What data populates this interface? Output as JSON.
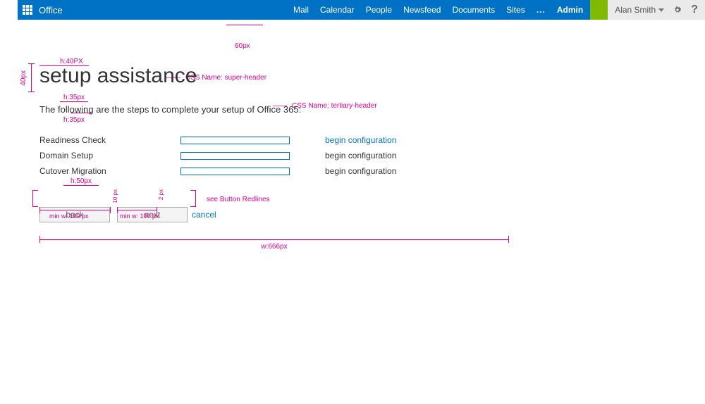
{
  "topbar": {
    "brand": "Office",
    "nav": {
      "mail": "Mail",
      "calendar": "Calendar",
      "people": "People",
      "newsfeed": "Newsfeed",
      "documents": "Documents",
      "sites": "Sites",
      "ellipsis": "...",
      "admin": "Admin"
    },
    "user": "Alan Smith",
    "help": "?"
  },
  "annotations": {
    "top_gap": "60px",
    "left_gap_vertical": "40px",
    "h40": "h:40PX",
    "h35a": "h:35px",
    "h35b": "h:35px",
    "css_super": "CSS Name:  super-header",
    "css_tertiary": "CSS Name: tertiary-header",
    "h50": "h:50px",
    "minw1": "min w: 100 px",
    "minw2": "min w: 100 px",
    "btn_gap1": "10 px",
    "btn_gap2": "2 px",
    "see_redlines": "see Button Redlines",
    "width": "w:666px"
  },
  "page": {
    "title": "setup assistance",
    "subtitle": "The following are the steps to complete your setup of Office 365:"
  },
  "steps": [
    {
      "label": "Readiness Check",
      "action": "begin configuration",
      "link": true
    },
    {
      "label": "Domain Setup",
      "action": "begin configuration",
      "link": false
    },
    {
      "label": "Cutover Migration",
      "action": "begin configuration",
      "link": false
    }
  ],
  "buttons": {
    "back": "back",
    "next": "next",
    "cancel": "cancel"
  }
}
